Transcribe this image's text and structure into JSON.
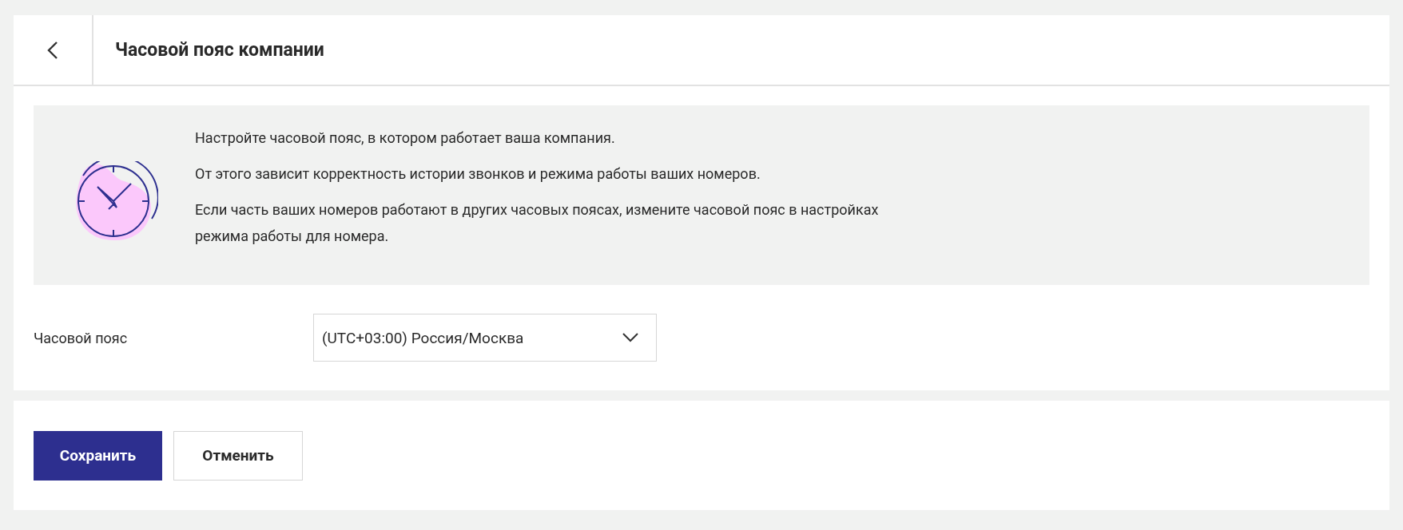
{
  "header": {
    "title": "Часовой пояс компании"
  },
  "info": {
    "paragraphs": [
      "Настройте часовой пояс, в котором работает ваша компания.",
      "От этого зависит корректность истории звонков и режима работы ваших номеров.",
      "Если часть ваших номеров работают в других часовых поясах, измените часовой пояс в настройках режима работы для номера."
    ]
  },
  "form": {
    "label": "Часовой пояс",
    "select": {
      "value": "(UTC+03:00) Россия/Москва"
    }
  },
  "buttons": [
    {
      "label": "Сохранить",
      "kind": "primary"
    },
    {
      "label": "Отменить",
      "kind": "secondary"
    }
  ]
}
